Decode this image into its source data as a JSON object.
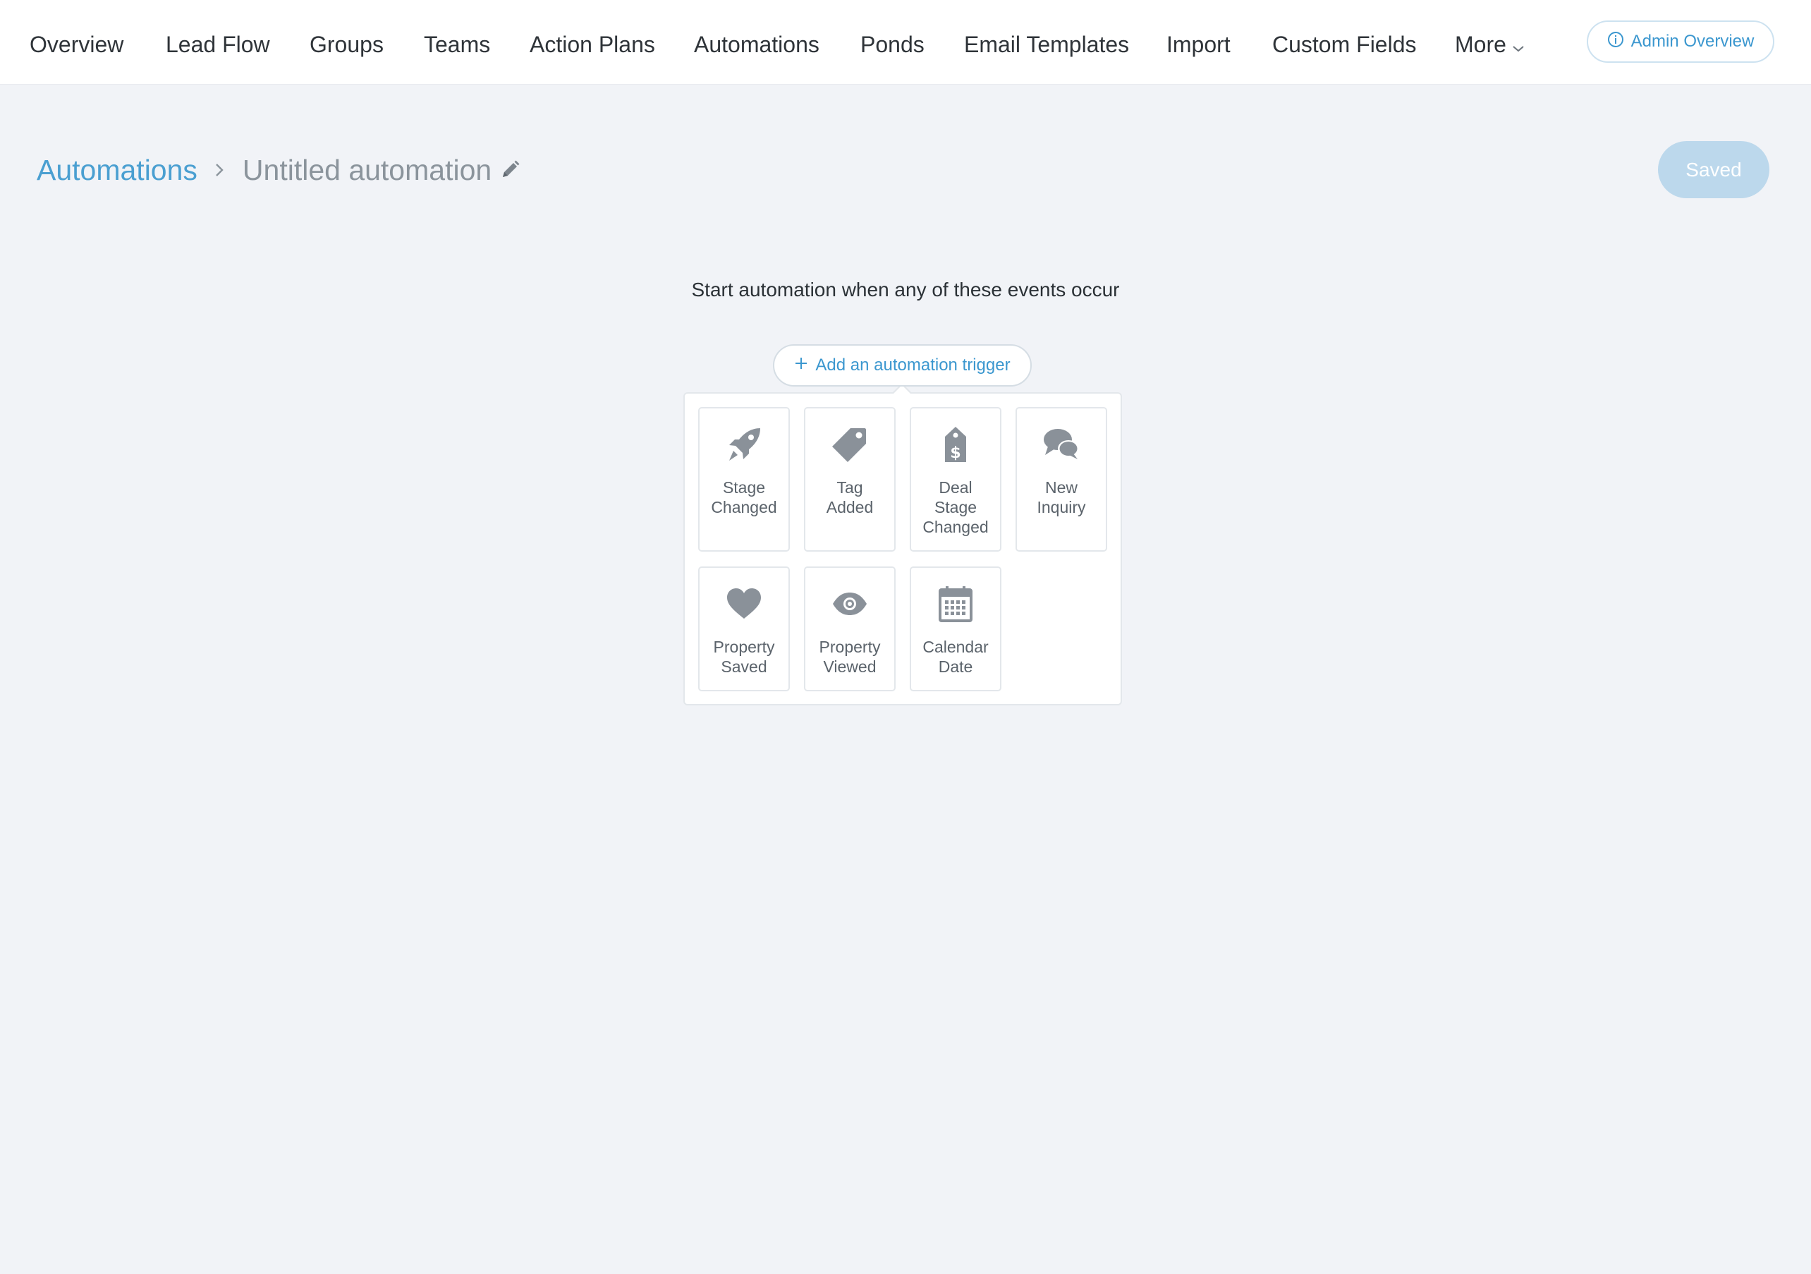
{
  "nav": {
    "items": [
      {
        "label": "Overview"
      },
      {
        "label": "Lead Flow"
      },
      {
        "label": "Groups"
      },
      {
        "label": "Teams"
      },
      {
        "label": "Action Plans"
      },
      {
        "label": "Automations"
      },
      {
        "label": "Ponds"
      },
      {
        "label": "Email Templates"
      },
      {
        "label": "Import"
      },
      {
        "label": "Custom Fields"
      },
      {
        "label": "More"
      }
    ],
    "admin_overview_label": "Admin Overview",
    "admin_overview_icon": "info-icon"
  },
  "breadcrumb": {
    "parent": "Automations",
    "current": "Untitled automation"
  },
  "saved_label": "Saved",
  "main": {
    "start_text": "Start automation when any of these events occur",
    "add_trigger_label": "Add an automation trigger"
  },
  "triggers": [
    {
      "line1": "Stage",
      "line2": "Changed",
      "line3": "",
      "icon": "rocket-icon"
    },
    {
      "line1": "Tag",
      "line2": "Added",
      "line3": "",
      "icon": "tag-icon"
    },
    {
      "line1": "Deal",
      "line2": "Stage",
      "line3": "Changed",
      "icon": "price-tag-dollar-icon"
    },
    {
      "line1": "New",
      "line2": "Inquiry",
      "line3": "",
      "icon": "chat-bubbles-icon"
    },
    {
      "line1": "Property",
      "line2": "Saved",
      "line3": "",
      "icon": "heart-icon"
    },
    {
      "line1": "Property",
      "line2": "Viewed",
      "line3": "",
      "icon": "eye-icon"
    },
    {
      "line1": "Calendar",
      "line2": "Date",
      "line3": "",
      "icon": "calendar-icon"
    }
  ],
  "colors": {
    "accent": "#3b97cf",
    "icon_gray": "#8a9199",
    "background": "#f1f3f7"
  }
}
